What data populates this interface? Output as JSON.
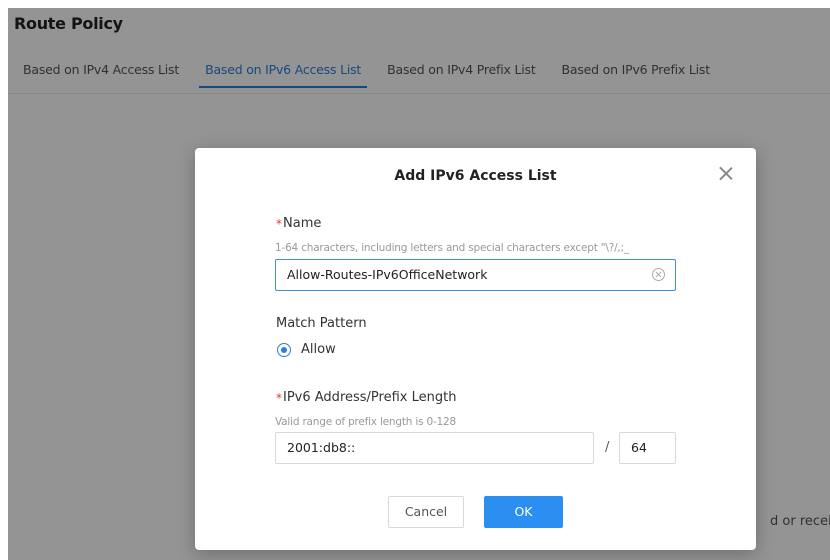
{
  "page": {
    "title": "Route Policy",
    "tabs": [
      {
        "label": "Based on IPv4 Access List",
        "active": false
      },
      {
        "label": "Based on IPv6 Access List",
        "active": true
      },
      {
        "label": "Based on IPv4 Prefix List",
        "active": false
      },
      {
        "label": "Based on IPv6 Prefix List",
        "active": false
      }
    ],
    "background_text": "d or receive"
  },
  "dialog": {
    "title": "Add IPv6 Access List",
    "name": {
      "required_mark": "*",
      "label": "Name",
      "hint": "1-64 characters, including letters and special characters except \"\\?/,;_",
      "value": "Allow-Routes-IPv6OfficeNetwork"
    },
    "match_pattern": {
      "label": "Match Pattern",
      "option": "Allow",
      "selected": true
    },
    "ipv6": {
      "required_mark": "*",
      "label": "IPv6 Address/Prefix Length",
      "hint": "Valid range of prefix length is 0-128",
      "address": "2001:db8::",
      "separator": "/",
      "prefix": "64"
    },
    "cancel_label": "Cancel",
    "ok_label": "OK"
  },
  "colors": {
    "accent": "#2a7fd6",
    "primary_button": "#2a8ff0",
    "required": "#e0393e",
    "overlay": "rgba(0,0,0,0.42)"
  },
  "icons": {
    "close": "close-icon",
    "clear": "clear-circle-icon"
  }
}
